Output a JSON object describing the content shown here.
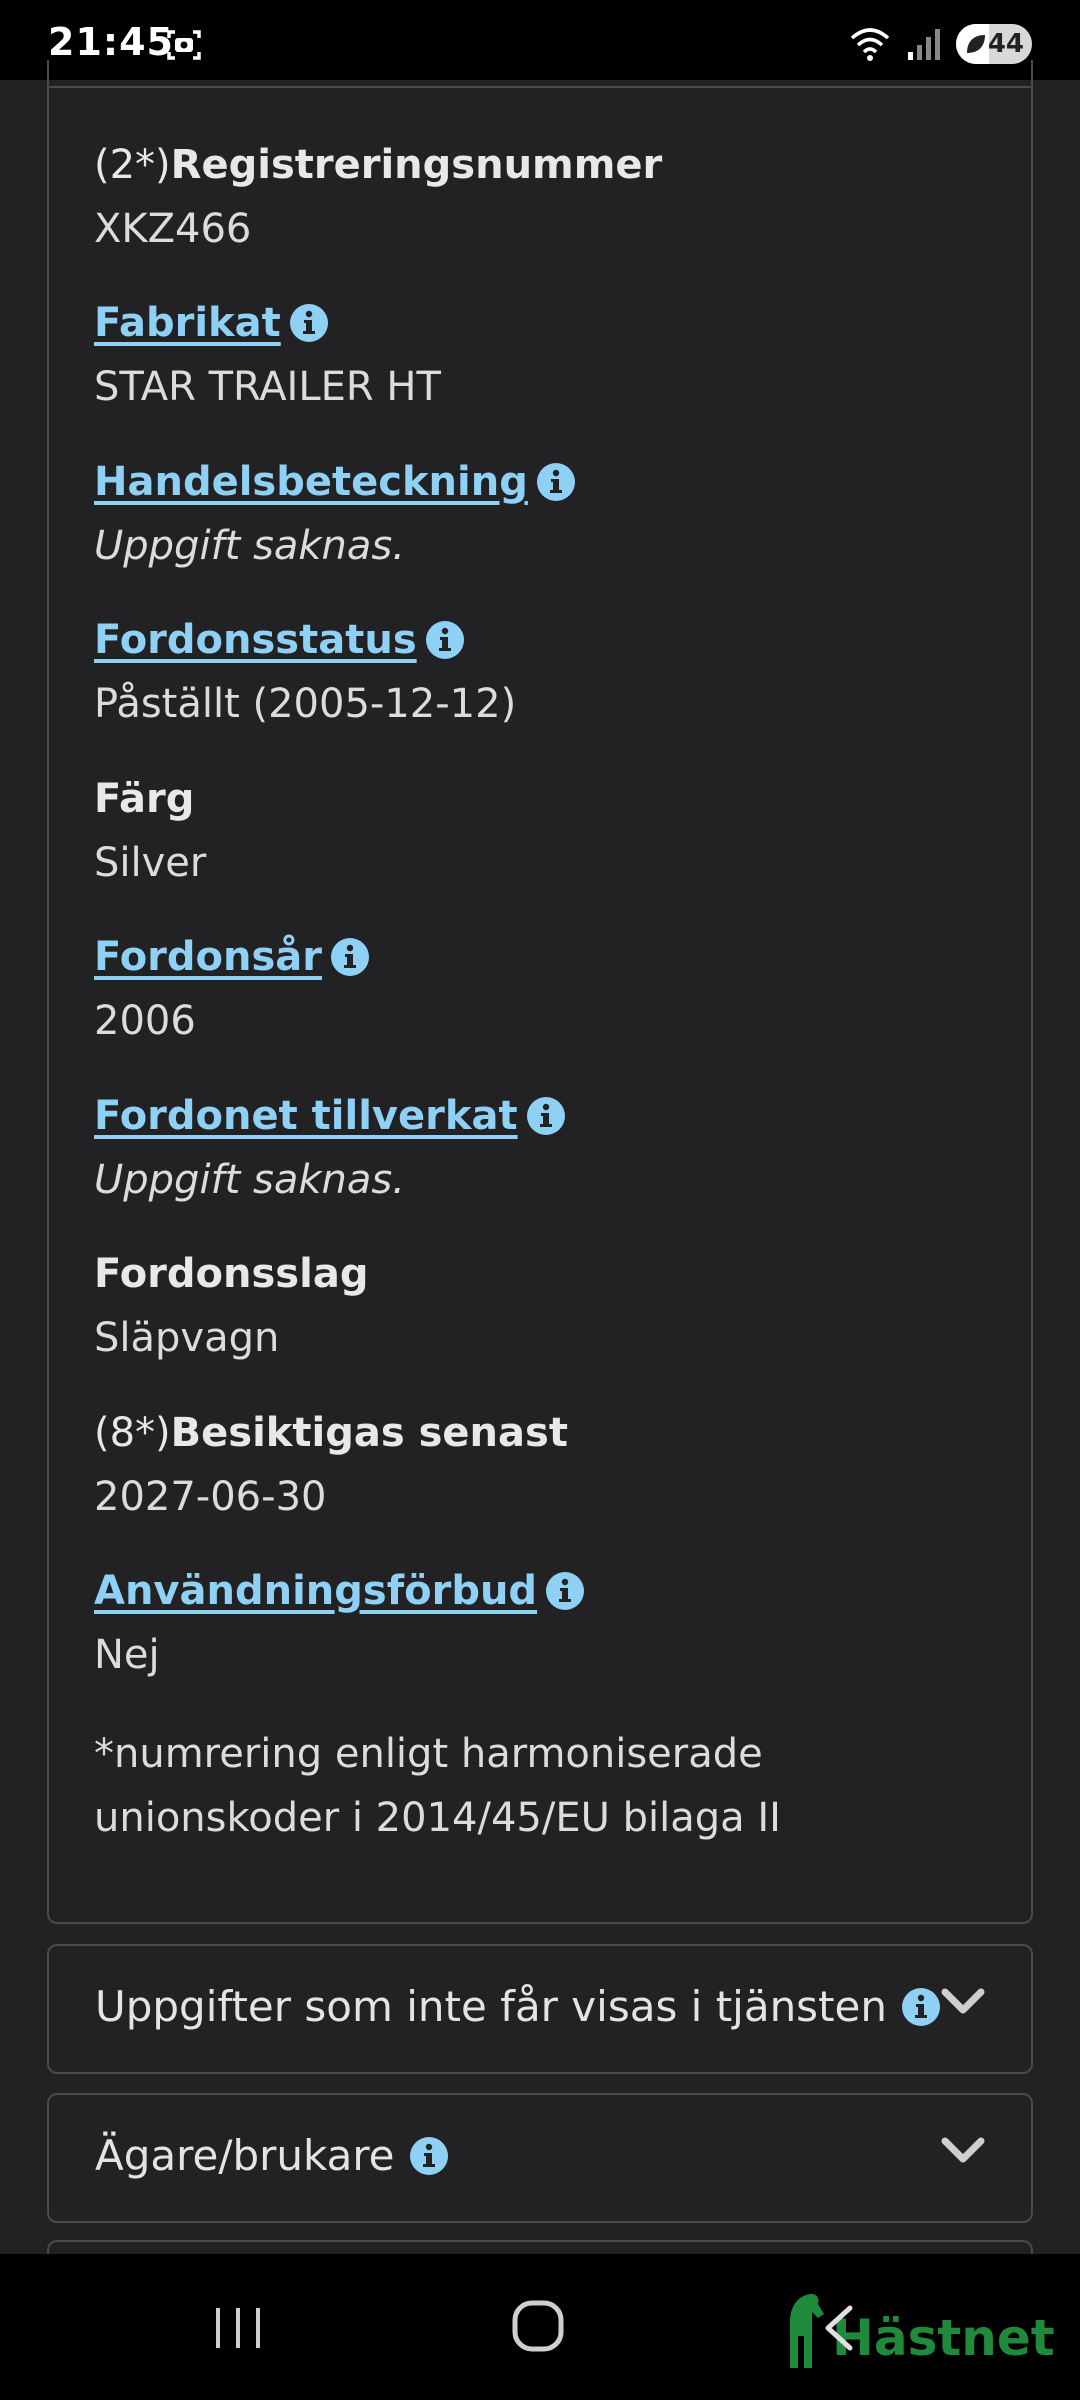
{
  "status_bar": {
    "time": "21:45",
    "battery": "44"
  },
  "details": [
    {
      "prefix": "(2*)",
      "label": "Registreringsnummer",
      "link": false,
      "info": false,
      "value": "XKZ466",
      "missing": false
    },
    {
      "prefix": "",
      "label": "Fabrikat",
      "link": true,
      "info": true,
      "value": "STAR TRAILER HT",
      "missing": false
    },
    {
      "prefix": "",
      "label": "Handelsbeteckning",
      "link": true,
      "info": true,
      "value": "Uppgift saknas.",
      "missing": true
    },
    {
      "prefix": "",
      "label": "Fordonsstatus",
      "link": true,
      "info": true,
      "value": "Påställt (2005-12-12)",
      "missing": false
    },
    {
      "prefix": "",
      "label": "Färg",
      "link": false,
      "info": false,
      "value": "Silver",
      "missing": false
    },
    {
      "prefix": "",
      "label": "Fordonsår",
      "link": true,
      "info": true,
      "value": "2006",
      "missing": false
    },
    {
      "prefix": "",
      "label": "Fordonet tillverkat",
      "link": true,
      "info": true,
      "value": "Uppgift saknas.",
      "missing": true
    },
    {
      "prefix": "",
      "label": "Fordonsslag",
      "link": false,
      "info": false,
      "value": "Släpvagn",
      "missing": false
    },
    {
      "prefix": "(8*)",
      "label": "Besiktigas senast",
      "link": false,
      "info": false,
      "value": "2027-06-30",
      "missing": false
    },
    {
      "prefix": "",
      "label": "Användningsförbud",
      "link": true,
      "info": true,
      "value": "Nej",
      "missing": false
    }
  ],
  "footnote": "*numrering enligt harmoniserade unionskoder i 2014/45/EU bilaga II",
  "accordions": [
    {
      "title": "Uppgifter som inte får visas i tjänsten"
    },
    {
      "title": "Ägare/brukare"
    }
  ],
  "logo": {
    "text": "Hästnet"
  },
  "colors": {
    "background": "#222224",
    "link": "#8fd0f5",
    "info_icon": "#8fd0f5",
    "logo": "#1f8a3c"
  }
}
